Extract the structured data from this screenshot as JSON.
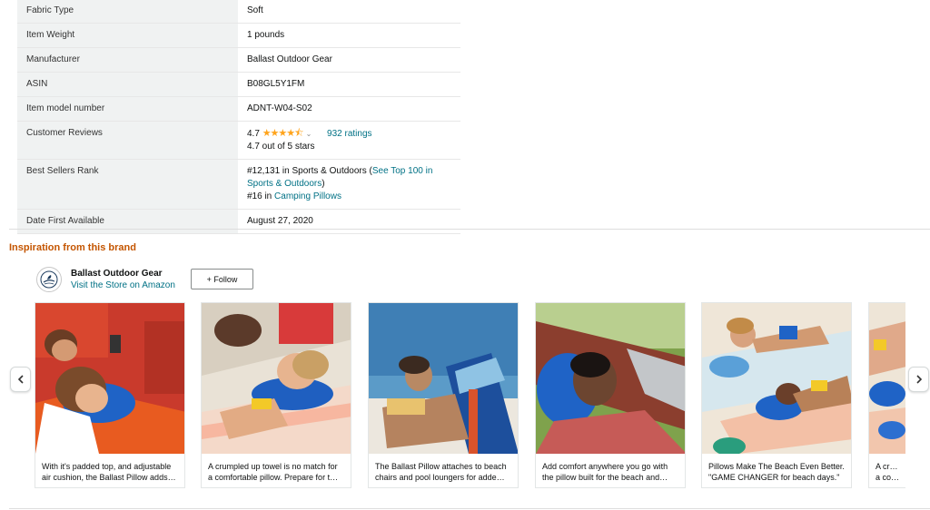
{
  "details": {
    "rows": [
      {
        "key": "Fabric Type",
        "value": "Soft"
      },
      {
        "key": "Item Weight",
        "value": "1 pounds"
      },
      {
        "key": "Manufacturer",
        "value": "Ballast Outdoor Gear"
      },
      {
        "key": "ASIN",
        "value": "B08GL5Y1FM"
      },
      {
        "key": "Item model number",
        "value": "ADNT-W04-S02"
      },
      {
        "key": "Customer Reviews",
        "rating": "4.7",
        "stars_text": "★★★★⯪",
        "ratings_link": "932 ratings",
        "out_of": "4.7 out of 5 stars"
      },
      {
        "key": "Best Sellers Rank",
        "rank1_prefix": "#12,131 in Sports & Outdoors (",
        "rank1_link": "See Top 100 in",
        "rank1_link2": "Sports & Outdoors",
        "rank1_suffix": ")",
        "rank2_prefix": "#16 in ",
        "rank2_link": "Camping Pillows"
      },
      {
        "key": "Date First Available",
        "value": "August 27, 2020"
      }
    ]
  },
  "inspiration": {
    "title": "Inspiration from this brand",
    "brand_name": "Ballast Outdoor Gear",
    "store_link": "Visit the Store on Amazon",
    "follow_label": "+ Follow",
    "cards": [
      {
        "line1": "With it's padded top, and adjustable",
        "line2": "air cushion, the Ballast Pillow adds…"
      },
      {
        "line1": "A crumpled up towel is no match for",
        "line2": "a comfortable pillow. Prepare for t…"
      },
      {
        "line1": "The Ballast Pillow attaches to beach",
        "line2": "chairs and pool loungers for adde…"
      },
      {
        "line1": "Add comfort anywhere you go with",
        "line2": "the pillow built for the beach and…"
      },
      {
        "line1": "Pillows Make The Beach Even Better.",
        "line2": "\"GAME CHANGER for beach days.\""
      },
      {
        "line1": "A crump",
        "line2": "a comfo"
      }
    ]
  },
  "colors": {
    "accent": "#c45500",
    "link": "#007185",
    "star": "#ffa41c"
  },
  "icons": {
    "prev": "chevron-left-icon",
    "next": "chevron-right-icon",
    "rating_dropdown": "chevron-down-icon",
    "brand_logo": "seagull-logo-icon"
  }
}
